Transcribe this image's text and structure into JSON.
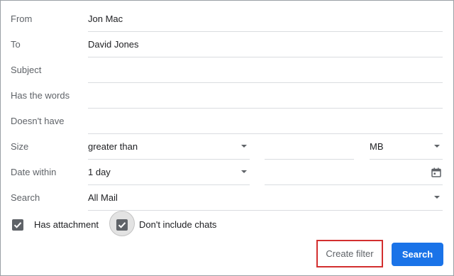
{
  "form": {
    "from": {
      "label": "From",
      "value": "Jon Mac"
    },
    "to": {
      "label": "To",
      "value": "David Jones"
    },
    "subject": {
      "label": "Subject",
      "value": ""
    },
    "has_words": {
      "label": "Has the words",
      "value": ""
    },
    "doesnt_have": {
      "label": "Doesn't have",
      "value": ""
    },
    "size": {
      "label": "Size",
      "operator": "greater than",
      "amount": "",
      "unit": "MB"
    },
    "date_within": {
      "label": "Date within",
      "range": "1 day",
      "date": ""
    },
    "search": {
      "label": "Search",
      "scope": "All Mail"
    }
  },
  "checkboxes": {
    "has_attachment": {
      "label": "Has attachment",
      "checked": true
    },
    "dont_include_chats": {
      "label": "Don't include chats",
      "checked": true
    }
  },
  "actions": {
    "create_filter": "Create filter",
    "search": "Search"
  },
  "colors": {
    "primary": "#1a73e8",
    "highlight_border": "#d32f2f",
    "checkbox": "#5f6368"
  },
  "icons": {
    "dropdown": "caret-down-icon",
    "calendar": "calendar-icon",
    "check": "checkmark-icon"
  }
}
